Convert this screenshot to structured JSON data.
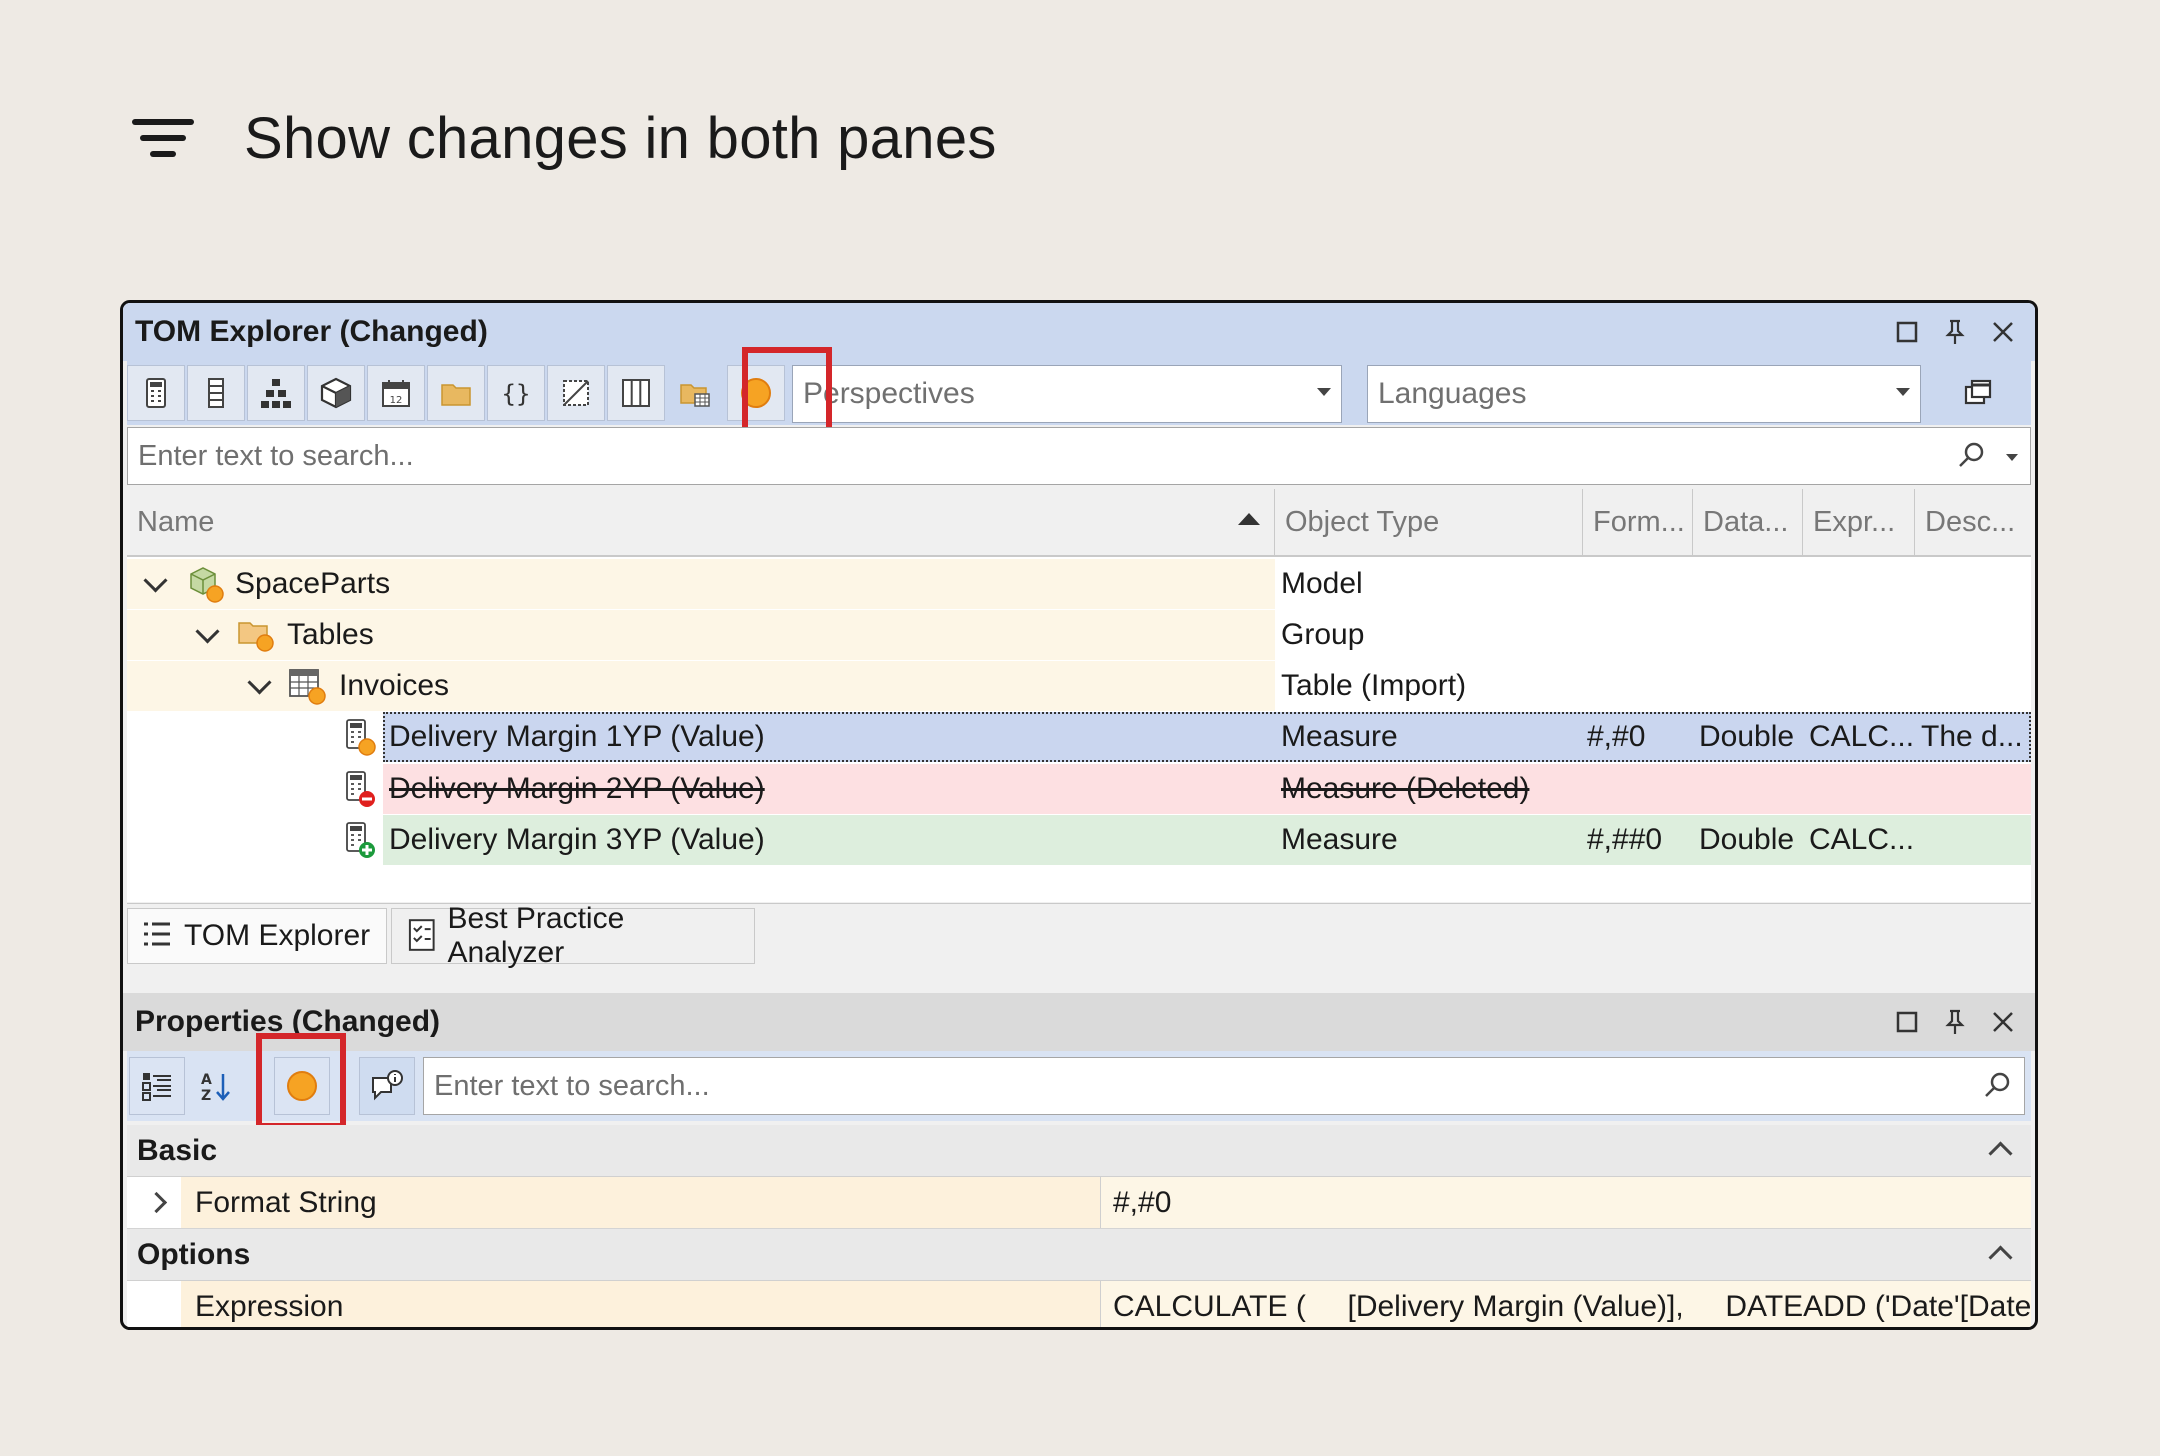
{
  "heading": {
    "text": "Show changes in both panes",
    "icon": "filter-lines-icon"
  },
  "tom": {
    "title": "TOM Explorer (Changed)",
    "perspectives_placeholder": "Perspectives",
    "languages_placeholder": "Languages",
    "search_placeholder": "Enter text to search...",
    "columns": {
      "name": "Name",
      "object_type": "Object Type",
      "format": "Form...",
      "data": "Data...",
      "expr": "Expr...",
      "desc": "Desc..."
    },
    "rows": [
      {
        "name": "SpaceParts",
        "type": "Model",
        "format": "",
        "data": "",
        "expr": "",
        "desc": "",
        "state": "changed"
      },
      {
        "name": "Tables",
        "type": "Group",
        "format": "",
        "data": "",
        "expr": "",
        "desc": "",
        "state": "changed"
      },
      {
        "name": "Invoices",
        "type": "Table (Import)",
        "format": "",
        "data": "",
        "expr": "",
        "desc": "",
        "state": "changed"
      },
      {
        "name": "Delivery Margin 1YP (Value)",
        "type": "Measure",
        "format": "#,#0",
        "data": "Double",
        "expr": "CALC...",
        "desc": "The d...",
        "state": "changed-selected"
      },
      {
        "name": "Delivery Margin 2YP (Value)",
        "type": "Measure (Deleted)",
        "format": "",
        "data": "",
        "expr": "",
        "desc": "",
        "state": "deleted"
      },
      {
        "name": "Delivery Margin 3YP (Value)",
        "type": "Measure",
        "format": "#,##0",
        "data": "Double",
        "expr": "CALC...",
        "desc": "",
        "state": "added"
      }
    ],
    "tabs": [
      "TOM Explorer",
      "Best Practice Analyzer"
    ],
    "colors": {
      "changed": "#f6a323",
      "deleted": "#fde0e2",
      "added": "#ddeedd",
      "selected": "#cad6ef",
      "highlight": "#d4262a"
    }
  },
  "props": {
    "title": "Properties (Changed)",
    "search_placeholder": "Enter text to search...",
    "sections": [
      {
        "label": "Basic",
        "rows": [
          {
            "name": "Format String",
            "value": "#,#0"
          }
        ]
      },
      {
        "label": "Options",
        "rows": [
          {
            "name": "Expression",
            "value": "CALCULATE (     [Delivery Margin (Value)],     DATEADD ('Date'[Date],..."
          }
        ]
      }
    ]
  }
}
